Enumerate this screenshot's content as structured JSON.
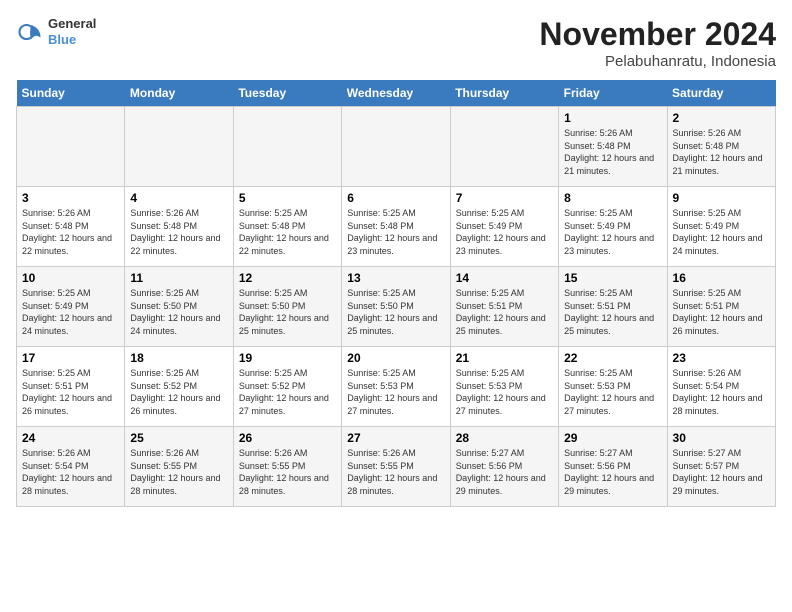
{
  "header": {
    "logo_line1": "General",
    "logo_line2": "Blue",
    "title": "November 2024",
    "subtitle": "Pelabuhanratu, Indonesia"
  },
  "days_of_week": [
    "Sunday",
    "Monday",
    "Tuesday",
    "Wednesday",
    "Thursday",
    "Friday",
    "Saturday"
  ],
  "weeks": [
    [
      {
        "day": "",
        "info": ""
      },
      {
        "day": "",
        "info": ""
      },
      {
        "day": "",
        "info": ""
      },
      {
        "day": "",
        "info": ""
      },
      {
        "day": "",
        "info": ""
      },
      {
        "day": "1",
        "info": "Sunrise: 5:26 AM\nSunset: 5:48 PM\nDaylight: 12 hours and 21 minutes."
      },
      {
        "day": "2",
        "info": "Sunrise: 5:26 AM\nSunset: 5:48 PM\nDaylight: 12 hours and 21 minutes."
      }
    ],
    [
      {
        "day": "3",
        "info": "Sunrise: 5:26 AM\nSunset: 5:48 PM\nDaylight: 12 hours and 22 minutes."
      },
      {
        "day": "4",
        "info": "Sunrise: 5:26 AM\nSunset: 5:48 PM\nDaylight: 12 hours and 22 minutes."
      },
      {
        "day": "5",
        "info": "Sunrise: 5:25 AM\nSunset: 5:48 PM\nDaylight: 12 hours and 22 minutes."
      },
      {
        "day": "6",
        "info": "Sunrise: 5:25 AM\nSunset: 5:48 PM\nDaylight: 12 hours and 23 minutes."
      },
      {
        "day": "7",
        "info": "Sunrise: 5:25 AM\nSunset: 5:49 PM\nDaylight: 12 hours and 23 minutes."
      },
      {
        "day": "8",
        "info": "Sunrise: 5:25 AM\nSunset: 5:49 PM\nDaylight: 12 hours and 23 minutes."
      },
      {
        "day": "9",
        "info": "Sunrise: 5:25 AM\nSunset: 5:49 PM\nDaylight: 12 hours and 24 minutes."
      }
    ],
    [
      {
        "day": "10",
        "info": "Sunrise: 5:25 AM\nSunset: 5:49 PM\nDaylight: 12 hours and 24 minutes."
      },
      {
        "day": "11",
        "info": "Sunrise: 5:25 AM\nSunset: 5:50 PM\nDaylight: 12 hours and 24 minutes."
      },
      {
        "day": "12",
        "info": "Sunrise: 5:25 AM\nSunset: 5:50 PM\nDaylight: 12 hours and 25 minutes."
      },
      {
        "day": "13",
        "info": "Sunrise: 5:25 AM\nSunset: 5:50 PM\nDaylight: 12 hours and 25 minutes."
      },
      {
        "day": "14",
        "info": "Sunrise: 5:25 AM\nSunset: 5:51 PM\nDaylight: 12 hours and 25 minutes."
      },
      {
        "day": "15",
        "info": "Sunrise: 5:25 AM\nSunset: 5:51 PM\nDaylight: 12 hours and 25 minutes."
      },
      {
        "day": "16",
        "info": "Sunrise: 5:25 AM\nSunset: 5:51 PM\nDaylight: 12 hours and 26 minutes."
      }
    ],
    [
      {
        "day": "17",
        "info": "Sunrise: 5:25 AM\nSunset: 5:51 PM\nDaylight: 12 hours and 26 minutes."
      },
      {
        "day": "18",
        "info": "Sunrise: 5:25 AM\nSunset: 5:52 PM\nDaylight: 12 hours and 26 minutes."
      },
      {
        "day": "19",
        "info": "Sunrise: 5:25 AM\nSunset: 5:52 PM\nDaylight: 12 hours and 27 minutes."
      },
      {
        "day": "20",
        "info": "Sunrise: 5:25 AM\nSunset: 5:53 PM\nDaylight: 12 hours and 27 minutes."
      },
      {
        "day": "21",
        "info": "Sunrise: 5:25 AM\nSunset: 5:53 PM\nDaylight: 12 hours and 27 minutes."
      },
      {
        "day": "22",
        "info": "Sunrise: 5:25 AM\nSunset: 5:53 PM\nDaylight: 12 hours and 27 minutes."
      },
      {
        "day": "23",
        "info": "Sunrise: 5:26 AM\nSunset: 5:54 PM\nDaylight: 12 hours and 28 minutes."
      }
    ],
    [
      {
        "day": "24",
        "info": "Sunrise: 5:26 AM\nSunset: 5:54 PM\nDaylight: 12 hours and 28 minutes."
      },
      {
        "day": "25",
        "info": "Sunrise: 5:26 AM\nSunset: 5:55 PM\nDaylight: 12 hours and 28 minutes."
      },
      {
        "day": "26",
        "info": "Sunrise: 5:26 AM\nSunset: 5:55 PM\nDaylight: 12 hours and 28 minutes."
      },
      {
        "day": "27",
        "info": "Sunrise: 5:26 AM\nSunset: 5:55 PM\nDaylight: 12 hours and 28 minutes."
      },
      {
        "day": "28",
        "info": "Sunrise: 5:27 AM\nSunset: 5:56 PM\nDaylight: 12 hours and 29 minutes."
      },
      {
        "day": "29",
        "info": "Sunrise: 5:27 AM\nSunset: 5:56 PM\nDaylight: 12 hours and 29 minutes."
      },
      {
        "day": "30",
        "info": "Sunrise: 5:27 AM\nSunset: 5:57 PM\nDaylight: 12 hours and 29 minutes."
      }
    ]
  ]
}
